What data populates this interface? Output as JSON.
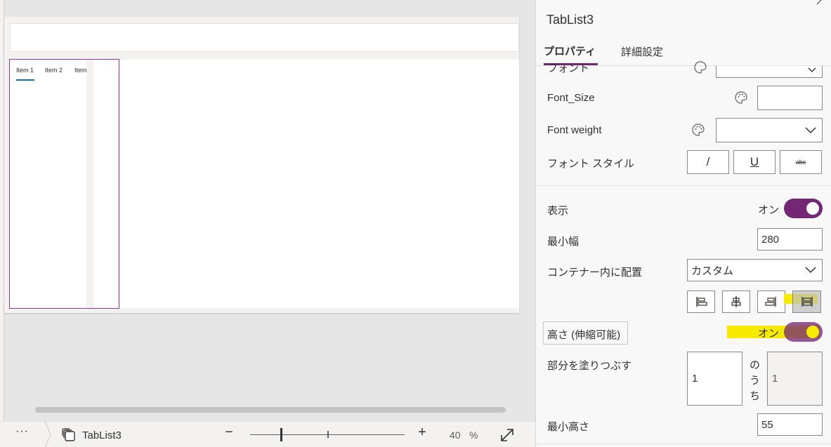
{
  "canvas": {
    "tabs": [
      {
        "label": "Item 1"
      },
      {
        "label": "Item 2"
      },
      {
        "label": "Item"
      }
    ]
  },
  "bottom_bar": {
    "more_label": "···",
    "component_name": "TabList3",
    "zoom_out_label": "−",
    "zoom_in_label": "+",
    "zoom_value": "40",
    "zoom_unit": "%"
  },
  "panel": {
    "title": "TabList3",
    "tabs": {
      "properties": "プロパティ",
      "advanced": "詳細設定"
    },
    "font_label": "フォント",
    "font_size_label": "Font_Size",
    "font_size_value": "",
    "font_weight_label": "Font weight",
    "font_weight_value": "",
    "font_style_label": "フォント スタイル",
    "font_style_buttons": {
      "italic": "/",
      "underline": "U",
      "strikethrough": "abc"
    },
    "visible_label": "表示",
    "visible_state": "オン",
    "visible_on": true,
    "min_width_label": "最小幅",
    "min_width_value": "280",
    "align_in_container_label": "コンテナー内に配置",
    "align_in_container_value": "カスタム",
    "flexible_height_label": "高さ (伸縮可能)",
    "flexible_height_state": "オン",
    "flexible_height_on": true,
    "fill_portions_label": "部分を塗りつぶす",
    "fill_portions_value": "1",
    "fill_portions_of": "の\nう\nち",
    "fill_portions_total": "1",
    "min_height_label": "最小高さ",
    "min_height_value": "55"
  },
  "colors": {
    "accent": "#742774",
    "highlight": "#f5ea00",
    "tab_underline": "#0f6cbd"
  }
}
